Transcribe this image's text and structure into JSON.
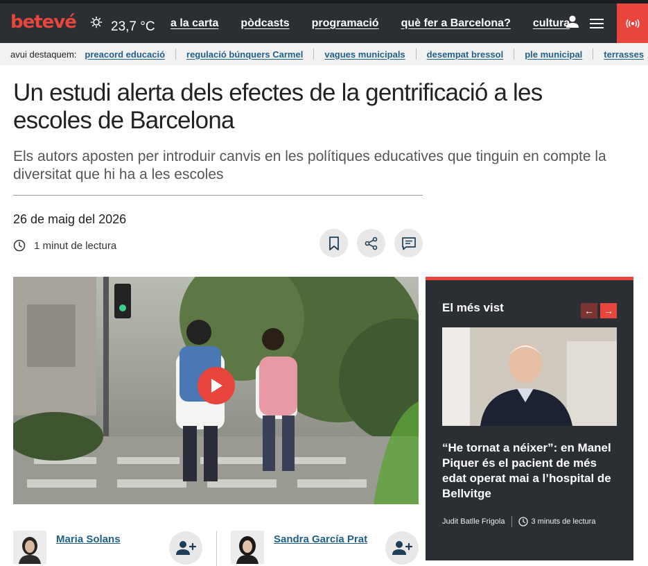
{
  "header": {
    "logo": "betevé",
    "weather": {
      "icon": "sun-icon",
      "temperature": "23,7 °C"
    },
    "nav": [
      "a la carta",
      "pòdcasts",
      "programació",
      "què fer a Barcelona?",
      "cultura"
    ],
    "icons": [
      "user-icon",
      "menu-icon",
      "live-broadcast-icon"
    ],
    "live_color": "#e8453c"
  },
  "highlights": {
    "label": "avui destaquem:",
    "items": [
      "preacord educació",
      "regulació búnquers Carmel",
      "vagues municipals",
      "desempat bressol",
      "ple municipal",
      "terrasses"
    ]
  },
  "article": {
    "title": "Un estudi alerta dels efectes de la gentrificació a les escoles de Barcelona",
    "subtitle": "Els autors aposten per introduir canvis en les polítiques educatives que tinguin en compte la diversitat que hi ha a les escoles",
    "date": "26 de maig del 2026",
    "reading_time": "1 minut de lectura",
    "actions": [
      "bookmark-icon",
      "share-icon",
      "comments-icon"
    ],
    "authors": [
      {
        "name": "Maria Solans"
      },
      {
        "name": "Sandra García Prat"
      }
    ]
  },
  "most_viewed": {
    "title": "El més vist",
    "headline": "“He tornat a néixer”: en Manel Piquer és el pacient de més edat operat mai a l’hospital de Bellvitge",
    "author": "Judit Batlle Frigola",
    "reading_time": "3 minuts de lectura"
  },
  "colors": {
    "accent": "#e8453c",
    "dark": "#2b2f33",
    "link": "#1f5f8b"
  }
}
